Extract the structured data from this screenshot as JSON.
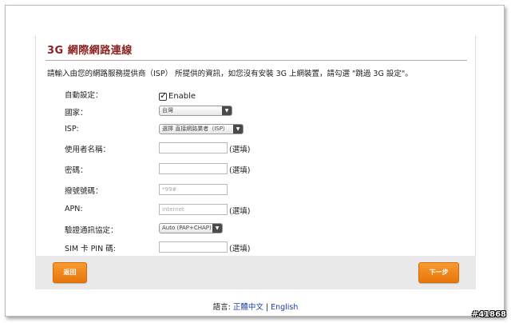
{
  "page": {
    "title": "3G 網際網路連線",
    "intro": "請輸入由您的網路服務提供商（ISP） 所提供的資訊，如您沒有安裝 3G 上網裝置，請勾選 \"跳過 3G 設定\"。"
  },
  "form": {
    "auto_setup": {
      "label": "自動設定：",
      "checkbox_label": "Enable",
      "checked": true
    },
    "country": {
      "label": "國家：",
      "selected": "台灣"
    },
    "isp": {
      "label": "ISP:",
      "selected": "選擇 直接網路業者（ISP）"
    },
    "username": {
      "label": "使用者名稱：",
      "value": "",
      "optional": "(選填)"
    },
    "password": {
      "label": "密碼：",
      "value": "",
      "optional": "(選填)"
    },
    "dial_number": {
      "label": "撥號號碼：",
      "placeholder": "*99#"
    },
    "apn": {
      "label": "APN:",
      "placeholder": "internet",
      "optional": "(選填)"
    },
    "auth_protocol": {
      "label": "驗證通訊協定：",
      "selected": "Auto (PAP+CHAP)"
    },
    "sim_pin": {
      "label": "SIM 卡 PIN 碼:",
      "value": "",
      "optional": "(選填)"
    }
  },
  "buttons": {
    "back": "返回",
    "next": "下一步"
  },
  "language": {
    "label": "語言:",
    "traditional_chinese": "正體中文",
    "separator": "|",
    "english": "English"
  },
  "watermark": "#41868",
  "colors": {
    "title": "#8b2321",
    "button": "#f08a1e",
    "link": "#1d3fa8"
  }
}
